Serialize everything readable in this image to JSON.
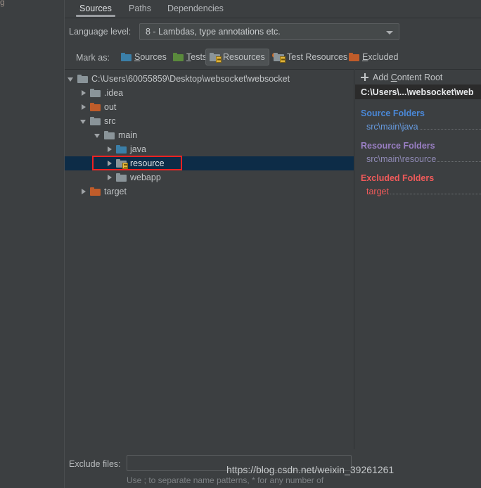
{
  "gutter": {
    "fragment_text": "g"
  },
  "tabs": [
    {
      "label": "Sources",
      "active": true
    },
    {
      "label": "Paths",
      "active": false
    },
    {
      "label": "Dependencies",
      "active": false
    }
  ],
  "language_level": {
    "label": "Language level:",
    "value": "8 - Lambdas, type annotations etc.",
    "arrow_icon": "chevron-down-icon"
  },
  "mark_as": {
    "label": "Mark as:",
    "buttons": [
      {
        "label": "Sources",
        "mnemonic": "S",
        "icon": "blue-folder-icon",
        "pressed": false
      },
      {
        "label": "Tests",
        "mnemonic": "T",
        "icon": "green-folder-icon",
        "pressed": false
      },
      {
        "label": "Resources",
        "mnemonic": "",
        "icon": "resource-folder-icon",
        "pressed": true
      },
      {
        "label": "Test Resources",
        "mnemonic": "",
        "icon": "test-resource-folder-icon",
        "pressed": false
      },
      {
        "label": "Excluded",
        "mnemonic": "E",
        "icon": "orange-folder-icon",
        "pressed": false
      }
    ]
  },
  "tree": {
    "rows": [
      {
        "label": "C:\\Users\\60055859\\Desktop\\websocket\\websocket",
        "indent": 0,
        "twisty": "down",
        "icon": "gray-folder-icon",
        "selected": false
      },
      {
        "label": ".idea",
        "indent": 1,
        "twisty": "right",
        "icon": "gray-folder-icon",
        "selected": false
      },
      {
        "label": "out",
        "indent": 1,
        "twisty": "right",
        "icon": "orange-folder-icon",
        "selected": false
      },
      {
        "label": "src",
        "indent": 1,
        "twisty": "down",
        "icon": "gray-folder-icon",
        "selected": false
      },
      {
        "label": "main",
        "indent": 2,
        "twisty": "down",
        "icon": "gray-folder-icon",
        "selected": false
      },
      {
        "label": "java",
        "indent": 3,
        "twisty": "right",
        "icon": "blue-folder-icon",
        "selected": false
      },
      {
        "label": "resource",
        "indent": 3,
        "twisty": "right",
        "icon": "resource-folder-icon",
        "selected": true
      },
      {
        "label": "webapp",
        "indent": 3,
        "twisty": "right",
        "icon": "gray-folder-icon",
        "selected": false
      },
      {
        "label": "target",
        "indent": 1,
        "twisty": "right",
        "icon": "orange-folder-icon",
        "selected": false
      }
    ],
    "highlight_color": "#ee2222",
    "selection_color": "#0d2c47"
  },
  "content_roots": {
    "add_label_pre": "Add ",
    "add_label_mnemonic": "C",
    "add_label_post": "ontent Root",
    "add_icon": "plus-icon",
    "root_path": "C:\\Users\\...\\websocket\\web",
    "sections": [
      {
        "title": "Source Folders",
        "items": [
          "src\\main\\java"
        ],
        "color": "#4a88d8"
      },
      {
        "title": "Resource Folders",
        "items": [
          "src\\main\\resource"
        ],
        "color": "#9a7fc4"
      },
      {
        "title": "Excluded Folders",
        "items": [
          "target"
        ],
        "color": "#f05a5a"
      }
    ]
  },
  "bottom": {
    "exclude_label": "Exclude files:",
    "exclude_value": "",
    "exclude_placeholder": "",
    "hint": "Use ; to separate name patterns, * for any number of"
  },
  "watermark": {
    "text": "https://blog.csdn.net/weixin_39261261"
  }
}
